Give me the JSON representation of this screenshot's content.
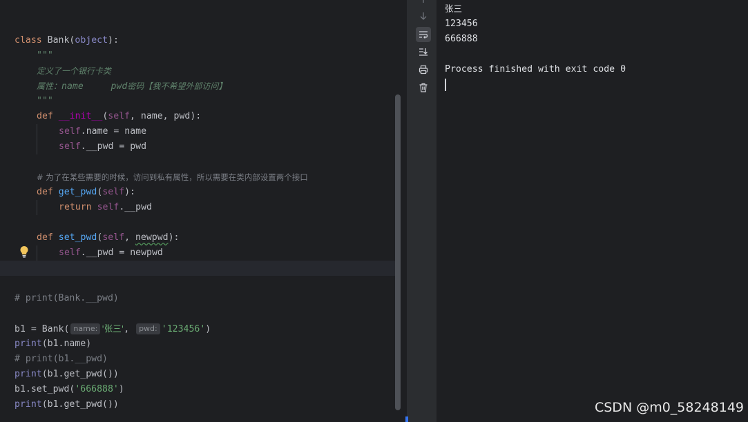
{
  "editor": {
    "line_class": {
      "kw": "class",
      "name": "Bank",
      "base": "object"
    },
    "doc_open": "\"\"\"",
    "doc_desc": "定义了一个银行卡类",
    "doc_attrs_prefix": "属性：",
    "doc_attrs_name": "name",
    "doc_attrs_pwd": "pwd",
    "doc_attrs_note": "密码【我不希望外部访问】",
    "doc_close": "\"\"\"",
    "init_def": {
      "kw": "def",
      "name": "__init__",
      "self": "self",
      "params": ", name, pwd):"
    },
    "init_body_1": {
      "self": "self",
      "rest": ".name = name"
    },
    "init_body_2": {
      "self": "self",
      "rest": ".__pwd = pwd"
    },
    "comment_access": "# 为了在某些需要的时候，访问到私有属性，所以需要在类内部设置两个接口",
    "get_def": {
      "kw": "def",
      "name": "get_pwd",
      "self": "self",
      "rest": "):"
    },
    "get_body": {
      "kw": "return",
      "self": "self",
      "rest": ".__pwd"
    },
    "set_def": {
      "kw": "def",
      "name": "set_pwd",
      "self": "self",
      "sep": ", ",
      "param": "newpwd",
      "rest": "):"
    },
    "set_body": {
      "self": "self",
      "rest": ".__pwd = newpwd"
    },
    "comment_print_bank": "# print(Bank.__pwd)",
    "b1_assign": {
      "prefix": "b1 = Bank(",
      "hint_name": "name:",
      "arg_name": "'张三'",
      "sep": ", ",
      "hint_pwd": "pwd:",
      "arg_pwd": "'123456'",
      "suffix": ")"
    },
    "print_name": {
      "fn": "print",
      "rest": "(b1.name)"
    },
    "comment_print_pwd": "# print(b1.__pwd)",
    "print_get_1": {
      "fn": "print",
      "rest": "(b1.get_pwd())"
    },
    "set_call": {
      "prefix": "b1.set_pwd(",
      "arg": "'666888'",
      "suffix": ")"
    },
    "print_get_2": {
      "fn": "print",
      "rest": "(b1.get_pwd())"
    }
  },
  "console": {
    "lines": [
      "张三",
      "123456",
      "666888",
      "",
      "Process finished with exit code 0"
    ]
  },
  "toolbar_icons": [
    "arrow-up-icon",
    "arrow-down-icon",
    "soft-wrap-icon",
    "scroll-to-end-icon",
    "print-icon",
    "trash-icon"
  ],
  "watermark": "CSDN @m0_58248149",
  "colors": {
    "background": "#1e1f22",
    "keyword": "#cf8e6d",
    "function": "#56a8f5",
    "string": "#6aab73",
    "comment": "#7a7e85",
    "self": "#94558d"
  }
}
